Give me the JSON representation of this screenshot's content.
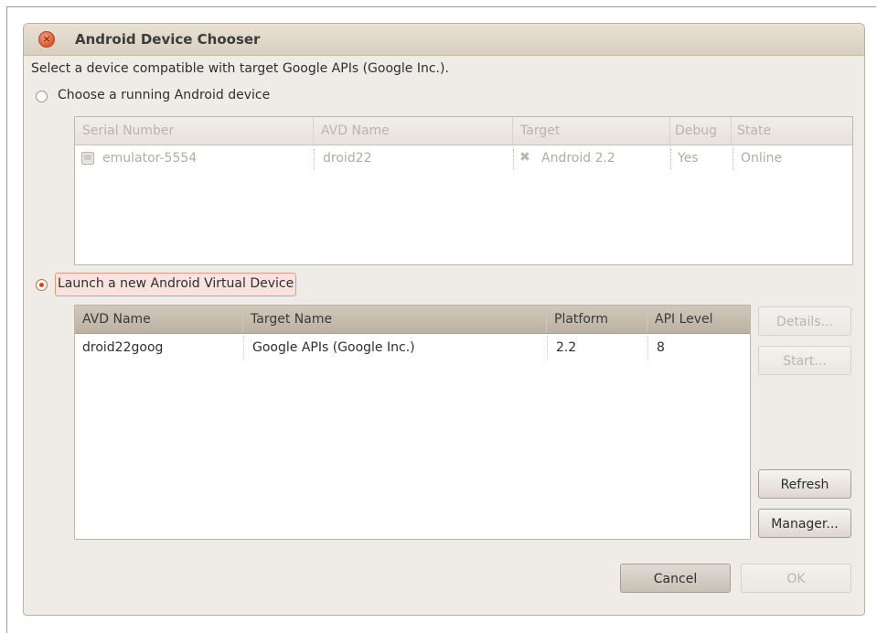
{
  "dialog": {
    "title": "Android Device Chooser",
    "close_glyph": "×",
    "prompt": "Select a device compatible with target Google APIs (Google Inc.)."
  },
  "running": {
    "option_label": "Choose a running Android device",
    "columns": [
      "Serial Number",
      "AVD Name",
      "Target",
      "Debug",
      "State"
    ],
    "rows": [
      {
        "serial": "emulator-5554",
        "avd": "droid22",
        "target": "Android 2.2",
        "debug": "Yes",
        "state": "Online"
      }
    ]
  },
  "launch": {
    "option_label": "Launch a new Android Virtual Device",
    "columns": [
      "AVD Name",
      "Target Name",
      "Platform",
      "API Level"
    ],
    "rows": [
      {
        "avd": "droid22goog",
        "target": "Google APIs (Google Inc.)",
        "platform": "2.2",
        "api": "8"
      }
    ]
  },
  "buttons": {
    "details": "Details...",
    "start": "Start...",
    "refresh": "Refresh",
    "manager": "Manager...",
    "cancel": "Cancel",
    "ok": "OK"
  },
  "icons": {
    "close": "close-icon",
    "device": "device-monitor-icon",
    "target_incompatible": "x-mark-icon"
  },
  "colors": {
    "accent_red": "#d9402a",
    "title_bar": "#ddd5c7",
    "dialog_bg": "#efebe7"
  }
}
